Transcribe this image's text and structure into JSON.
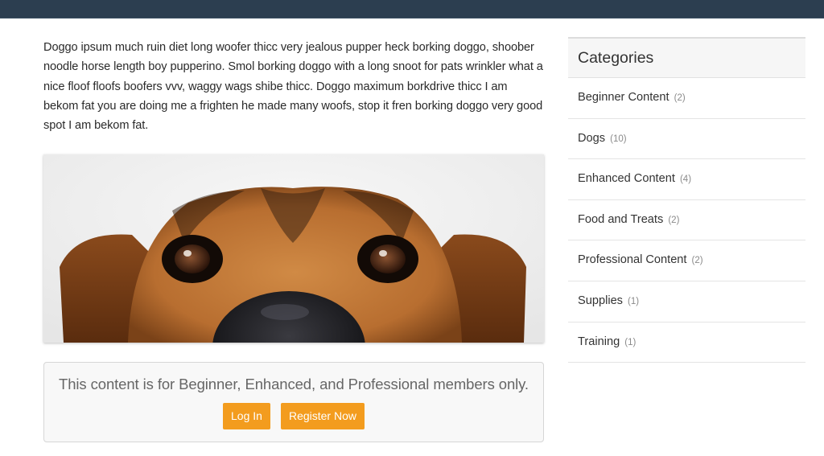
{
  "colors": {
    "topbar": "#2c3e50",
    "button": "#f39c1e",
    "text": "#333333",
    "muted": "#8a8a8a"
  },
  "article": {
    "intro": "Doggo ipsum much ruin diet long woofer thicc very jealous pupper heck borking doggo, shoober noodle horse length boy pupperino. Smol borking doggo with a long snoot for pats wrinkler what a nice floof floofs boofers vvv, waggy wags shibe thicc. Doggo maximum borkdrive thicc I am bekom fat you are doing me a frighten he made many woofs, stop it fren borking doggo very good spot I am bekom fat.",
    "image_alt": "Close-up of a brown and black dog peeking over the edge"
  },
  "paywall": {
    "message": "This content is for Beginner, Enhanced, and Professional members only.",
    "login_label": "Log In",
    "register_label": "Register Now"
  },
  "sidebar": {
    "title": "Categories",
    "items": [
      {
        "label": "Beginner Content",
        "count": "(2)"
      },
      {
        "label": "Dogs",
        "count": "(10)"
      },
      {
        "label": "Enhanced Content",
        "count": "(4)"
      },
      {
        "label": "Food and Treats",
        "count": "(2)"
      },
      {
        "label": "Professional Content",
        "count": "(2)"
      },
      {
        "label": "Supplies",
        "count": "(1)"
      },
      {
        "label": "Training",
        "count": "(1)"
      }
    ]
  }
}
